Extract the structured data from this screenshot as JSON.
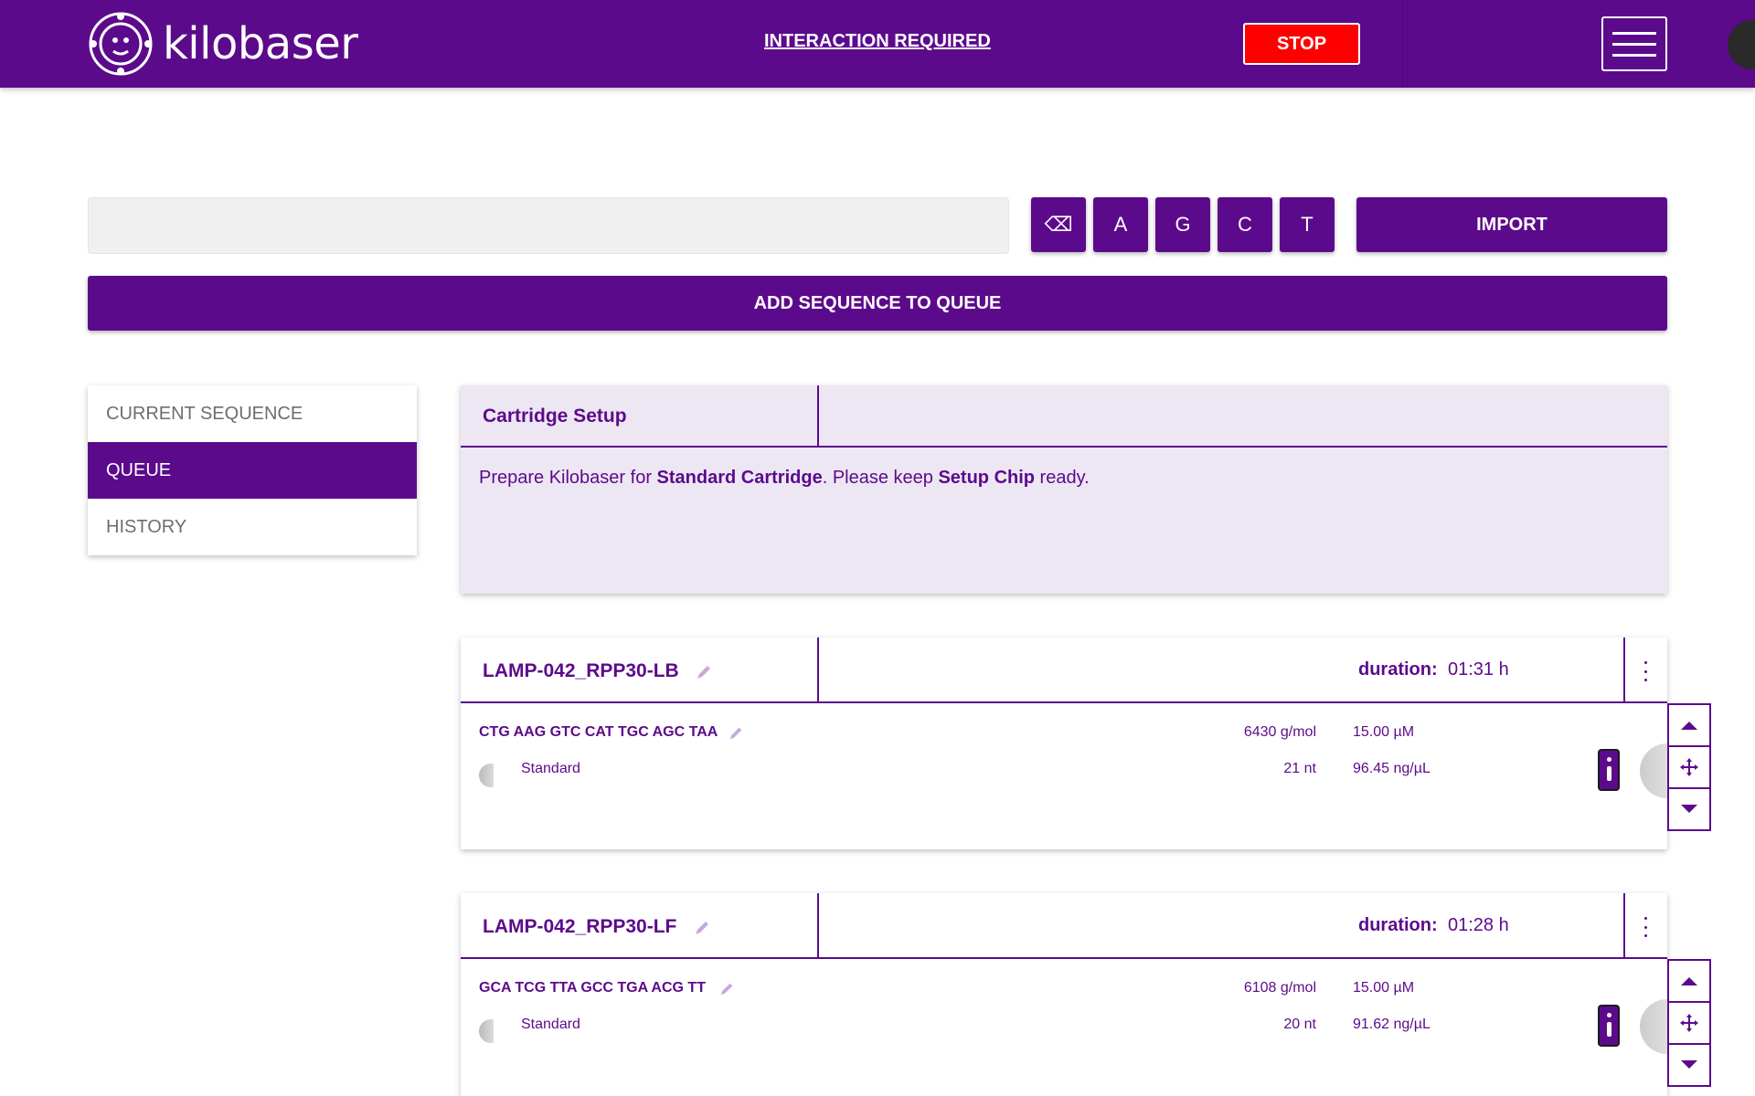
{
  "header": {
    "brand": "kilobaser",
    "interaction_link": "INTERACTION REQUIRED",
    "stop_label": "STOP",
    "colors": {
      "primary": "#5c0a8c",
      "stop": "#ff0000"
    }
  },
  "input": {
    "sequence_value": "",
    "keys": [
      "⌫",
      "A",
      "G",
      "C",
      "T"
    ],
    "import_label": "IMPORT",
    "add_label": "ADD SEQUENCE TO QUEUE"
  },
  "sidebar": {
    "items": [
      {
        "label": "CURRENT SEQUENCE",
        "active": false
      },
      {
        "label": "QUEUE",
        "active": true
      },
      {
        "label": "HISTORY",
        "active": false
      }
    ]
  },
  "setup": {
    "title": "Cartridge Setup",
    "text_1": "Prepare Kilobaser for ",
    "bold_1": "Standard Cartridge",
    "text_2": ". Please keep ",
    "bold_2": "Setup Chip",
    "text_3": " ready."
  },
  "queue": [
    {
      "name": "LAMP-042_RPP30-LB",
      "duration_label": "duration:",
      "duration": "01:31 h",
      "sequence": "CTG AAG GTC CAT TGC AGC TAA",
      "type": "Standard",
      "mw": "6430 g/mol",
      "length": "21 nt",
      "concentration": "15.00 µM",
      "mass_conc": "96.45 ng/µL"
    },
    {
      "name": "LAMP-042_RPP30-LF",
      "duration_label": "duration:",
      "duration": "01:28 h",
      "sequence": "GCA TCG TTA GCC TGA ACG TT",
      "type": "Standard",
      "mw": "6108 g/mol",
      "length": "20 nt",
      "concentration": "15.00 µM",
      "mass_conc": "91.62 ng/µL"
    }
  ]
}
